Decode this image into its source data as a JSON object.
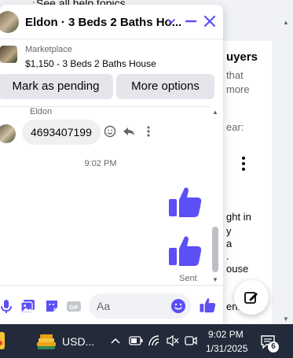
{
  "background": {
    "help_link": "See all help topics",
    "heading_fragment": "uyers",
    "text_lines": [
      "that",
      "more",
      "ear:",
      "ght in",
      "y",
      "a",
      ".",
      "ouse",
      "ent"
    ]
  },
  "chat": {
    "title": "Eldon · 3 Beds 2 Baths Ho...",
    "listing_label": "Marketplace",
    "listing_title": "$1,150 - 3 Beds 2 Baths House",
    "mark_pending_label": "Mark as pending",
    "more_options_label": "More options",
    "sender_name": "Eldon",
    "message_text": "4693407199",
    "timestamp": "9:02 PM",
    "sent_label": "Sent",
    "composer_placeholder": "Aa",
    "accent_color": "#5b4ff5"
  },
  "taskbar": {
    "stock_label": "USD...",
    "time": "9:02 PM",
    "date": "1/31/2025",
    "notification_count": "6"
  }
}
